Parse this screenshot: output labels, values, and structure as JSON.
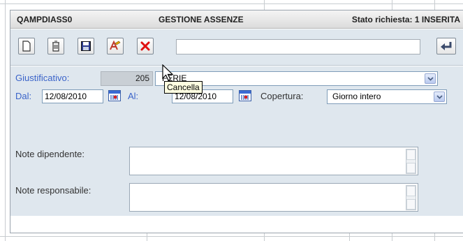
{
  "header": {
    "code": "QAMPDIASS0",
    "title": "GESTIONE ASSENZE",
    "status": "Stato richiesta: 1 INSERITA"
  },
  "toolbar": {
    "buttons": [
      {
        "icon": "new-document-icon"
      },
      {
        "icon": "delete-document-icon"
      },
      {
        "icon": "save-icon"
      },
      {
        "icon": "spell-check-icon"
      },
      {
        "icon": "cancel-icon",
        "tooltip": "Cancella"
      }
    ],
    "status_text": "",
    "back_icon": "return-arrow-icon"
  },
  "form": {
    "giustificativo": {
      "label": "Giustificativo:",
      "code": "205",
      "description": "FERIE"
    },
    "dal": {
      "label": "Dal:",
      "value": "12/08/2010"
    },
    "al": {
      "label": "Al:",
      "value": "12/08/2010"
    },
    "copertura": {
      "label": "Copertura:",
      "value": "Giorno intero"
    },
    "note_dipendente": {
      "label": "Note dipendente:",
      "value": ""
    },
    "note_responsabile": {
      "label": "Note responsabile:",
      "value": ""
    }
  },
  "tooltip": "Cancella",
  "colors": {
    "label_blue": "#3a63c9",
    "panel_bg": "#dfe7ee",
    "cancel_red": "#e01010"
  }
}
